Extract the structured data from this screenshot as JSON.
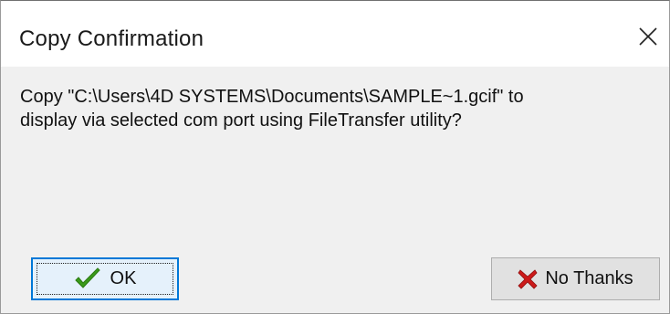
{
  "window": {
    "title": "Copy Confirmation"
  },
  "message": {
    "line1": "Copy \"C:\\Users\\4D SYSTEMS\\Documents\\SAMPLE~1.gcif\" to",
    "line2": "display via selected com port using FileTransfer utility?"
  },
  "buttons": {
    "ok_label": "OK",
    "no_thanks_label": "No Thanks"
  },
  "icons": {
    "ok": "check-icon",
    "no_thanks": "x-icon",
    "close": "close-icon"
  },
  "colors": {
    "check": "#3a9a1a",
    "cross": "#cc1a1a",
    "focus_border": "#0078d7"
  }
}
